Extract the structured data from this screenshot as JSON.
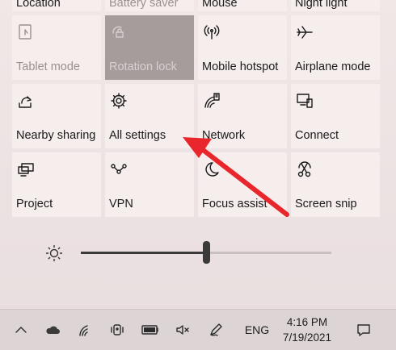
{
  "quick_actions": {
    "row0": [
      {
        "label": "Location",
        "state": "cut"
      },
      {
        "label": "Battery saver",
        "state": "cut"
      },
      {
        "label": "Mouse",
        "state": "cut"
      },
      {
        "label": "Night light",
        "state": "cut"
      }
    ],
    "row1": [
      {
        "label": "Tablet mode",
        "icon": "tablet-mode-icon",
        "state": "disabled"
      },
      {
        "label": "Rotation lock",
        "icon": "rotation-lock-icon",
        "state": "disabled-dark"
      },
      {
        "label": "Mobile hotspot",
        "icon": "hotspot-icon",
        "state": "off"
      },
      {
        "label": "Airplane mode",
        "icon": "airplane-icon",
        "state": "off"
      }
    ],
    "row2": [
      {
        "label": "Nearby sharing",
        "icon": "nearby-sharing-icon",
        "state": "off"
      },
      {
        "label": "All settings",
        "icon": "gear-icon",
        "state": "off"
      },
      {
        "label": "Network",
        "icon": "network-icon",
        "state": "off"
      },
      {
        "label": "Connect",
        "icon": "connect-icon",
        "state": "off"
      }
    ],
    "row3": [
      {
        "label": "Project",
        "icon": "project-icon",
        "state": "off"
      },
      {
        "label": "VPN",
        "icon": "vpn-icon",
        "state": "off"
      },
      {
        "label": "Focus assist",
        "icon": "moon-icon",
        "state": "off"
      },
      {
        "label": "Screen snip",
        "icon": "scissors-icon",
        "state": "off"
      }
    ]
  },
  "brightness": {
    "icon": "sun-icon",
    "level": 0.5
  },
  "taskbar": {
    "icons": [
      "chevron-up-icon",
      "onedrive-cloud-icon",
      "wifi-icon",
      "webcam-icon",
      "battery-icon",
      "volume-muted-icon",
      "pen-icon"
    ],
    "language": "ENG",
    "time": "4:16 PM",
    "date": "7/19/2021",
    "notification_icon": "action-center-icon"
  },
  "annotation": {
    "type": "red-arrow",
    "color": "#e8262b",
    "points_to": "All settings"
  }
}
